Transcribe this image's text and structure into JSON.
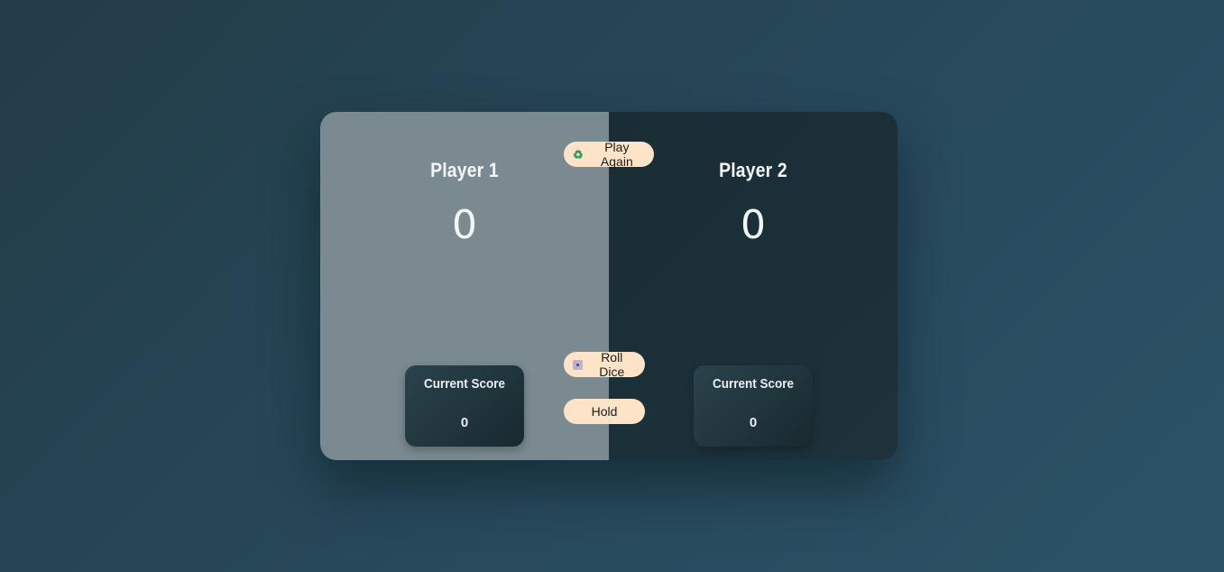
{
  "players": [
    {
      "name": "Player 1",
      "score": "0",
      "current_label": "Current Score",
      "current_score": "0"
    },
    {
      "name": "Player 2",
      "score": "0",
      "current_label": "Current Score",
      "current_score": "0"
    }
  ],
  "controls": {
    "new_game": {
      "label": "Play Again",
      "icon": "recycle-icon"
    },
    "roll": {
      "label": "Roll Dice",
      "icon": "dice-icon"
    },
    "hold": {
      "label": "Hold"
    }
  },
  "colors": {
    "active_panel": "#7a8a90",
    "inactive_panel": "#1b2f38",
    "button": "#fde3c8"
  }
}
